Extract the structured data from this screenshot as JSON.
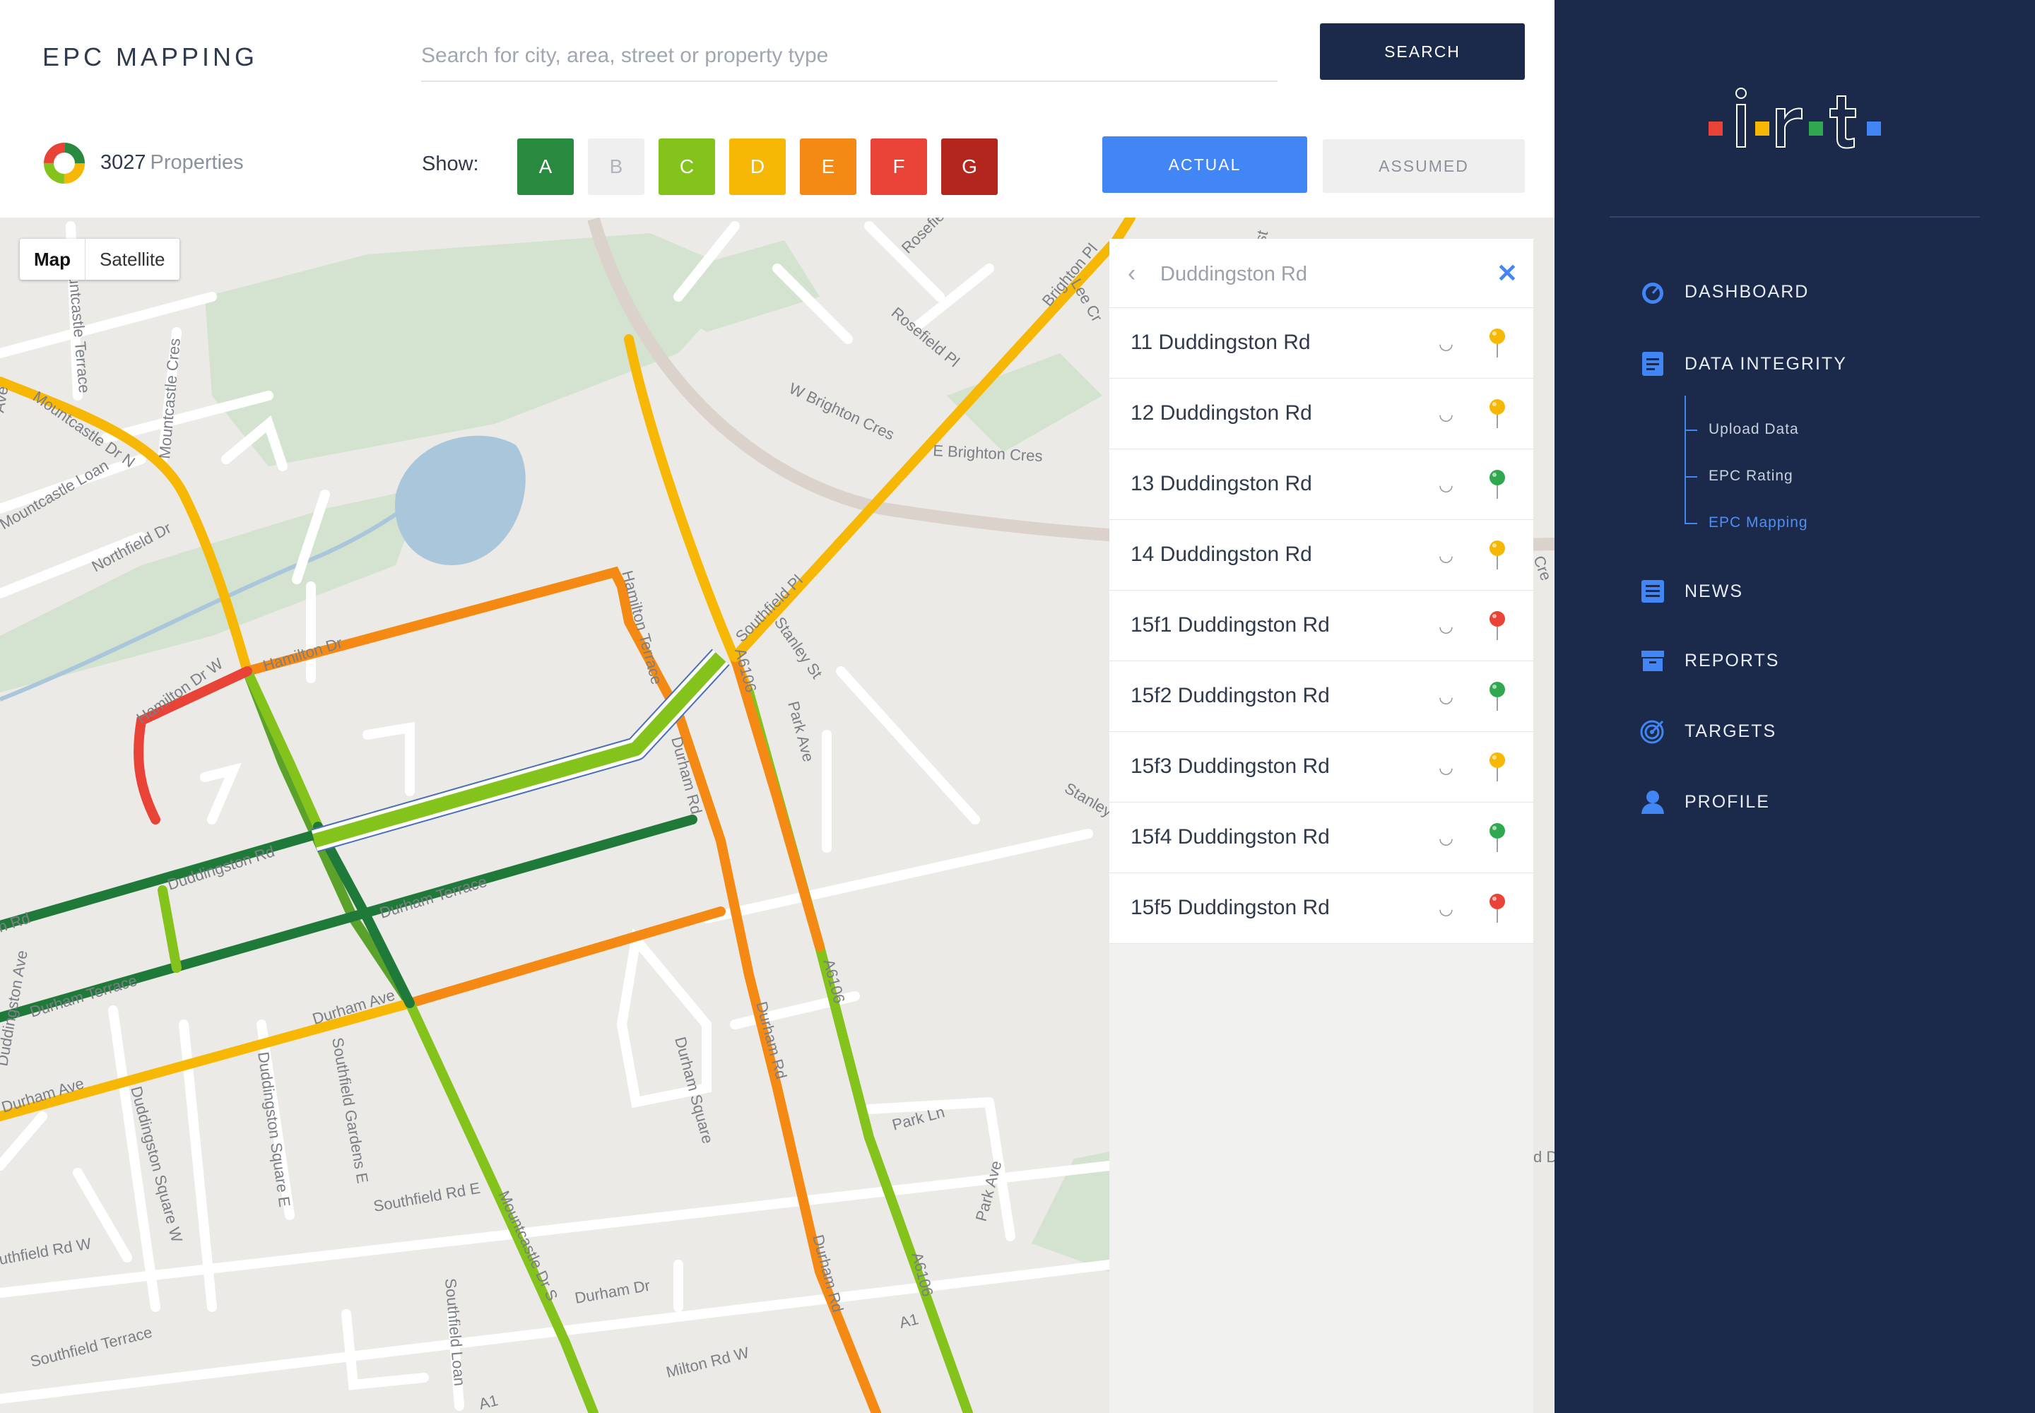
{
  "header": {
    "title": "EPC MAPPING",
    "search_placeholder": "Search for city, area, street or property type",
    "search_button": "SEARCH",
    "properties_count": "3027",
    "properties_label": "Properties",
    "show_label": "Show:",
    "ratings": [
      {
        "label": "A",
        "color": "#278a3e",
        "active": true
      },
      {
        "label": "B",
        "color": "#efefef",
        "active": false
      },
      {
        "label": "C",
        "color": "#84c21c",
        "active": true
      },
      {
        "label": "D",
        "color": "#f6b804",
        "active": true
      },
      {
        "label": "E",
        "color": "#f48a14",
        "active": true
      },
      {
        "label": "F",
        "color": "#e94337",
        "active": true
      },
      {
        "label": "G",
        "color": "#b3261e",
        "active": true
      }
    ],
    "actual_button": "ACTUAL",
    "assumed_button": "ASSUMED"
  },
  "map": {
    "type_map": "Map",
    "type_satellite": "Satellite",
    "labels": {
      "mountcastle_terrace": "Mountcastle Terrace",
      "mountcastle_cres": "Mountcastle Cres",
      "mountcastle_dr_n": "Mountcastle Dr N",
      "mountcastle_loan": "Mountcastle Loan",
      "northfield_dr": "Northfield Dr",
      "hamilton_dr_w": "Hamilton Dr W",
      "hamilton_dr": "Hamilton Dr",
      "hamilton_terrace": "Hamilton Terrace",
      "duddingston_rd": "Duddingston Rd",
      "durham_terrace": "Durham Terrace",
      "durham_ave": "Durham Ave",
      "durham_rd": "Durham Rd",
      "durham_square": "Durham Square",
      "durham_dr": "Durham Dr",
      "a6106": "A6106",
      "southfield_pl": "Southfield Pl",
      "stanley_st": "Stanley St",
      "park_ave": "Park Ave",
      "park_ln": "Park Ln",
      "brighton_pl": "Brighton Pl",
      "rosefield_pl": "Rosefield Pl",
      "rosefie": "Rosefie",
      "w_brighton_cres": "W Brighton Cres",
      "e_brighton_cres": "E Brighton Cres",
      "lee_cr": "Lee Cr",
      "southfield_rd_e": "Southfield Rd E",
      "southfield_rd_w": "uthfield Rd W",
      "southfield_terrace": "Southfield Terrace",
      "southfield_loan": "Southfield Loan",
      "southfield_gardens_e": "Southfield Gardens E",
      "duddingston_square_e": "Duddingston Square E",
      "duddingston_square_w": "Duddingston Square W",
      "duddingston_ave": "Duddingston Ave",
      "mountcastle_dr_s": "Mountcastle Dr S",
      "milton_rd_w": "Milton Rd W",
      "a1": "A1",
      "a1b": "A1",
      "ave": "Ave",
      "stanley": "Stanley",
      "ield_terrace": "ield Terrace",
      "st": "st",
      "cre": "Cre",
      "d": "d D",
      "rd_left": "n Rd"
    }
  },
  "results": {
    "query": "Duddingston Rd",
    "items": [
      {
        "address": "11 Duddingston Rd",
        "pin_color": "#f6b804"
      },
      {
        "address": "12 Duddingston Rd",
        "pin_color": "#f6b804"
      },
      {
        "address": "13 Duddingston Rd",
        "pin_color": "#2fa84f"
      },
      {
        "address": "14 Duddingston Rd",
        "pin_color": "#f6b804"
      },
      {
        "address": "15f1 Duddingston Rd",
        "pin_color": "#e94337"
      },
      {
        "address": "15f2 Duddingston Rd",
        "pin_color": "#2fa84f"
      },
      {
        "address": "15f3 Duddingston Rd",
        "pin_color": "#f6b804"
      },
      {
        "address": "15f4 Duddingston Rd",
        "pin_color": "#2fa84f"
      },
      {
        "address": "15f5 Duddingston Rd",
        "pin_color": "#e94337"
      }
    ]
  },
  "sidebar": {
    "nav": [
      {
        "label": "DASHBOARD",
        "icon": "gauge-icon"
      },
      {
        "label": "DATA INTEGRITY",
        "icon": "document-icon"
      },
      {
        "label": "NEWS",
        "icon": "news-icon"
      },
      {
        "label": "REPORTS",
        "icon": "archive-icon"
      },
      {
        "label": "TARGETS",
        "icon": "target-icon"
      },
      {
        "label": "PROFILE",
        "icon": "user-icon"
      }
    ],
    "sub": [
      {
        "label": "Upload Data",
        "active": false
      },
      {
        "label": "EPC Rating",
        "active": false
      },
      {
        "label": "EPC Mapping",
        "active": true
      }
    ]
  }
}
